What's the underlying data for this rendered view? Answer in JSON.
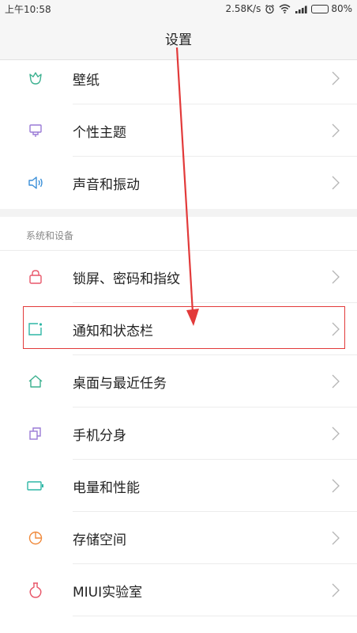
{
  "status_bar": {
    "time": "上午10:58",
    "network_speed": "2.58K/s",
    "battery_percent": "80%",
    "battery_level": 0.8,
    "icons": [
      "alarm-icon",
      "wifi-icon",
      "signal-icon",
      "battery-icon"
    ]
  },
  "header": {
    "title": "设置"
  },
  "section_top": {
    "items": [
      {
        "label": "壁纸",
        "icon": "wallpaper-icon",
        "icon_color": "#3bb08f"
      },
      {
        "label": "个性主题",
        "icon": "theme-icon",
        "icon_color": "#9a7ad6"
      },
      {
        "label": "声音和振动",
        "icon": "sound-icon",
        "icon_color": "#3a8fd8"
      }
    ]
  },
  "section_system": {
    "header": "系统和设备",
    "items": [
      {
        "label": "锁屏、密码和指纹",
        "icon": "lock-icon",
        "icon_color": "#e8576a"
      },
      {
        "label": "通知和状态栏",
        "icon": "notification-icon",
        "icon_color": "#2fb7a6",
        "highlighted": true
      },
      {
        "label": "桌面与最近任务",
        "icon": "home-icon",
        "icon_color": "#3bb08f"
      },
      {
        "label": "手机分身",
        "icon": "dual-icon",
        "icon_color": "#9a7ad6"
      },
      {
        "label": "电量和性能",
        "icon": "battery-perf-icon",
        "icon_color": "#2fb7a6"
      },
      {
        "label": "存储空间",
        "icon": "storage-icon",
        "icon_color": "#f08a3c"
      },
      {
        "label": "MIUI实验室",
        "icon": "lab-icon",
        "icon_color": "#e8576a"
      }
    ]
  },
  "colors": {
    "annotation_red": "#e23a3a",
    "chevron": "#b5b5b5"
  }
}
